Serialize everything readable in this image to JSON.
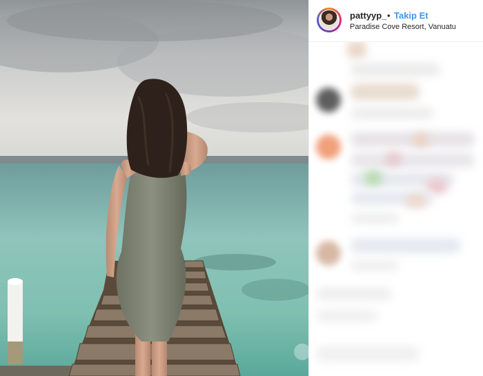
{
  "post": {
    "username": "pattyyp_",
    "separator": "•",
    "follow_label": "Takip Et",
    "location": "Paradise Cove Resort, Vanuatu"
  },
  "icons": {
    "profile": "avatar-icon"
  }
}
